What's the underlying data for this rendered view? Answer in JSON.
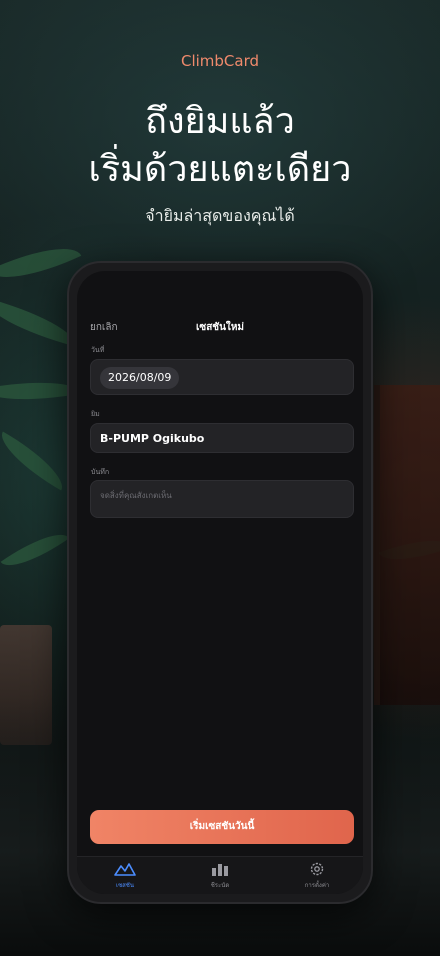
{
  "app": {
    "brand": "ClimbCard"
  },
  "hero": {
    "headline_line1": "ถึงยิมแล้ว",
    "headline_line2": "เริ่มด้วยแตะเดียว",
    "subhead": "จำยิมล่าสุดของคุณได้"
  },
  "form": {
    "cancel_label": "ยกเลิก",
    "title": "เซสชันใหม่",
    "date_label": "วันที่",
    "date_value": "2026/08/09",
    "gym_label": "ยิม",
    "gym_value": "B-PUMP Ogikubo",
    "note_label": "บันทึก",
    "note_placeholder": "จดสิ่งที่คุณสังเกตเห็น",
    "start_button": "เริ่มเซสชันวันนี้"
  },
  "tabs": [
    {
      "label": "เซสชัน",
      "icon": "mountain-icon",
      "active": true
    },
    {
      "label": "ชีระนัด",
      "icon": "bar-chart-icon",
      "active": false
    },
    {
      "label": "การตั้งค่า",
      "icon": "gear-icon",
      "active": false
    }
  ],
  "colors": {
    "accent": "#f08a6c",
    "cta_start": "#f08466",
    "cta_end": "#e0654c",
    "tab_active": "#4c8dff"
  }
}
